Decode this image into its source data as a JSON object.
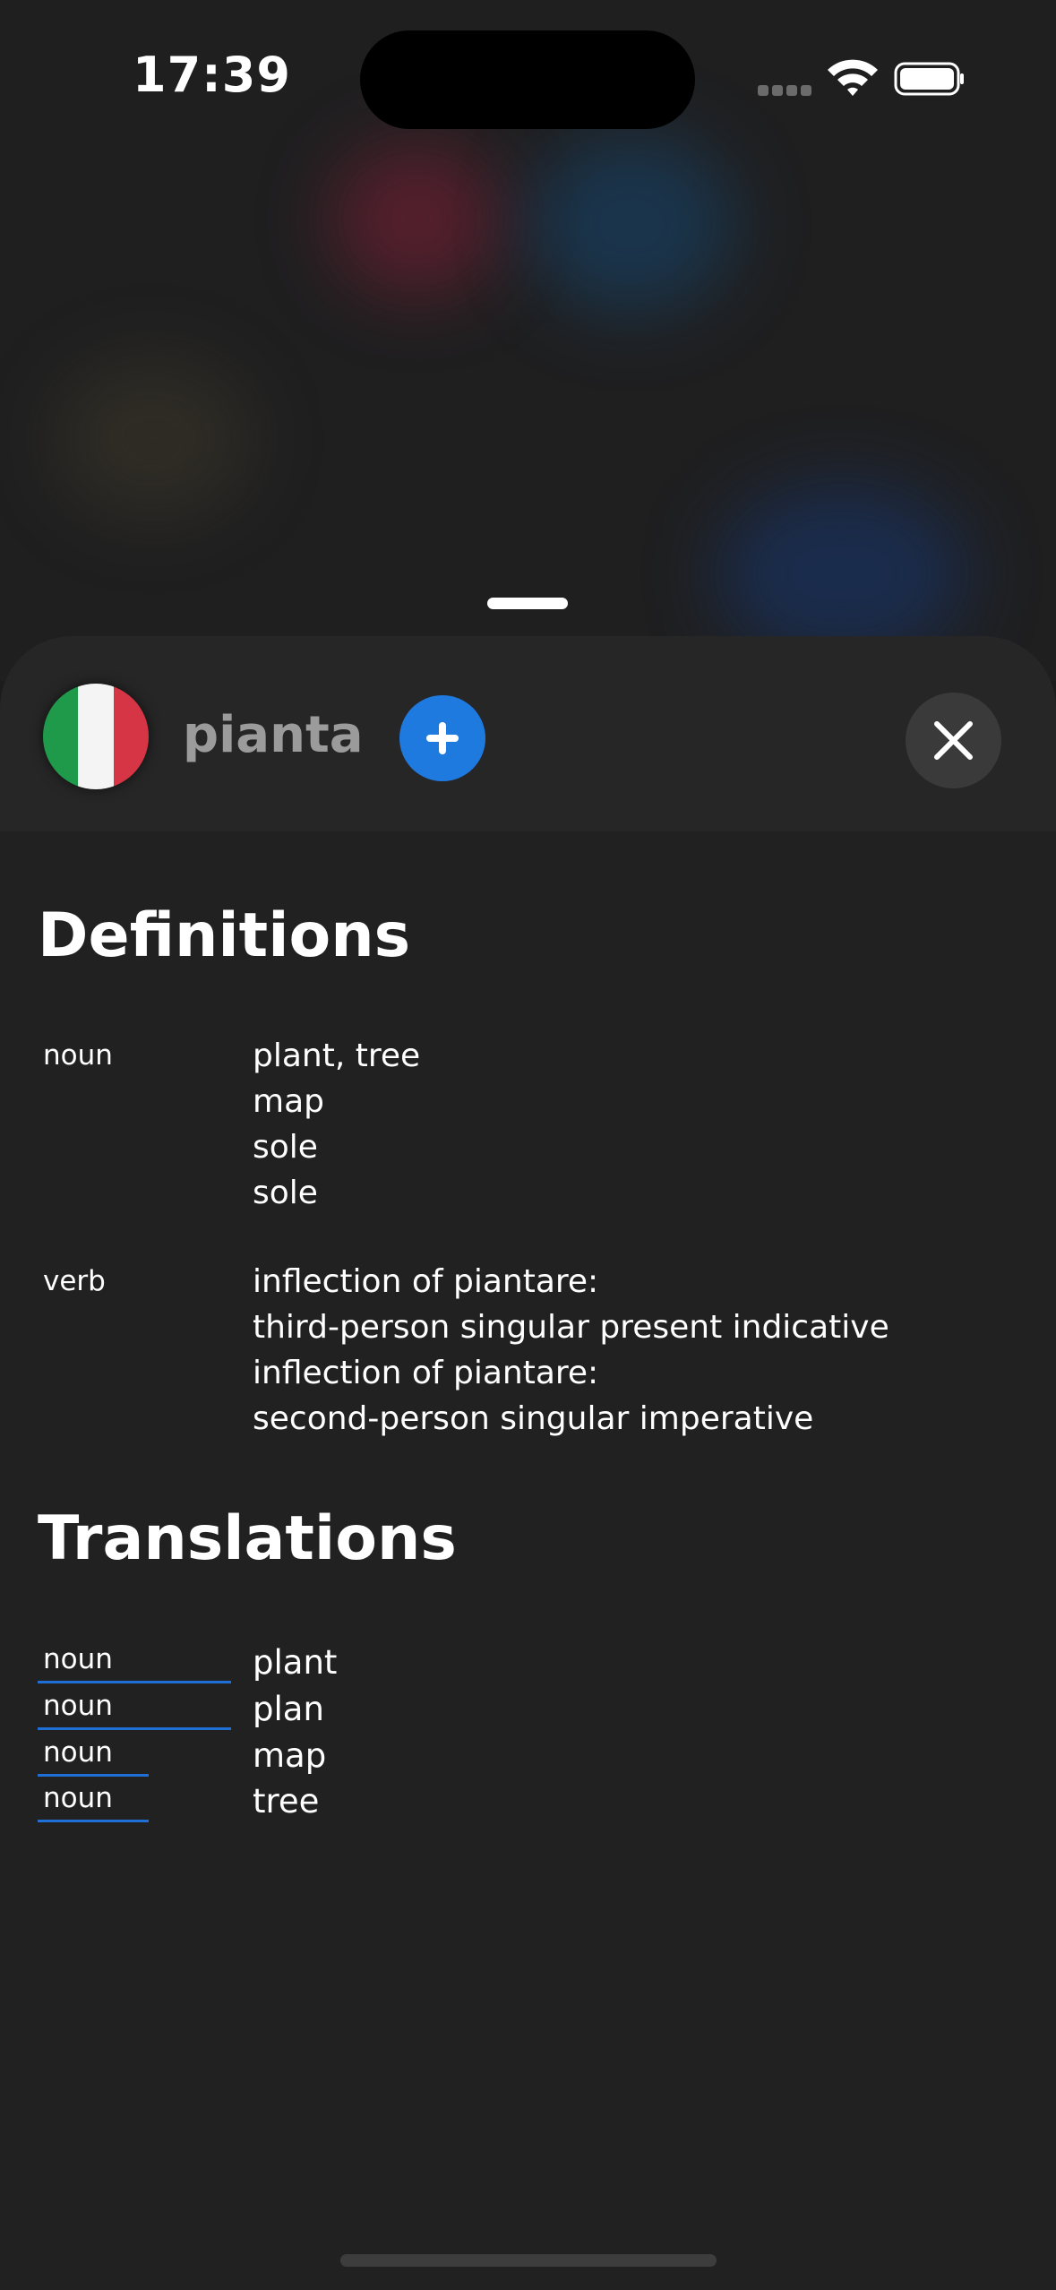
{
  "status": {
    "time": "17:39"
  },
  "header": {
    "flag_colors": [
      "#1f9a4a",
      "#f4f4f4",
      "#d63545"
    ],
    "word": "pianta",
    "add_icon": "plus-icon",
    "close_icon": "close-icon",
    "accent": "#1f7ae0"
  },
  "definitions": {
    "title": "Definitions",
    "groups": [
      {
        "pos": "noun",
        "items": [
          "plant, tree",
          "map",
          "sole",
          "sole"
        ]
      },
      {
        "pos": "verb",
        "items": [
          "inflection of piantare:",
          "third-person singular present indicative",
          "inflection of piantare:",
          "second-person singular imperative"
        ]
      }
    ]
  },
  "translations": {
    "title": "Translations",
    "rows": [
      {
        "pos": "noun",
        "value": "plant"
      },
      {
        "pos": "noun",
        "value": "plan"
      },
      {
        "pos": "noun",
        "value": "map"
      },
      {
        "pos": "noun",
        "value": "tree"
      }
    ]
  }
}
